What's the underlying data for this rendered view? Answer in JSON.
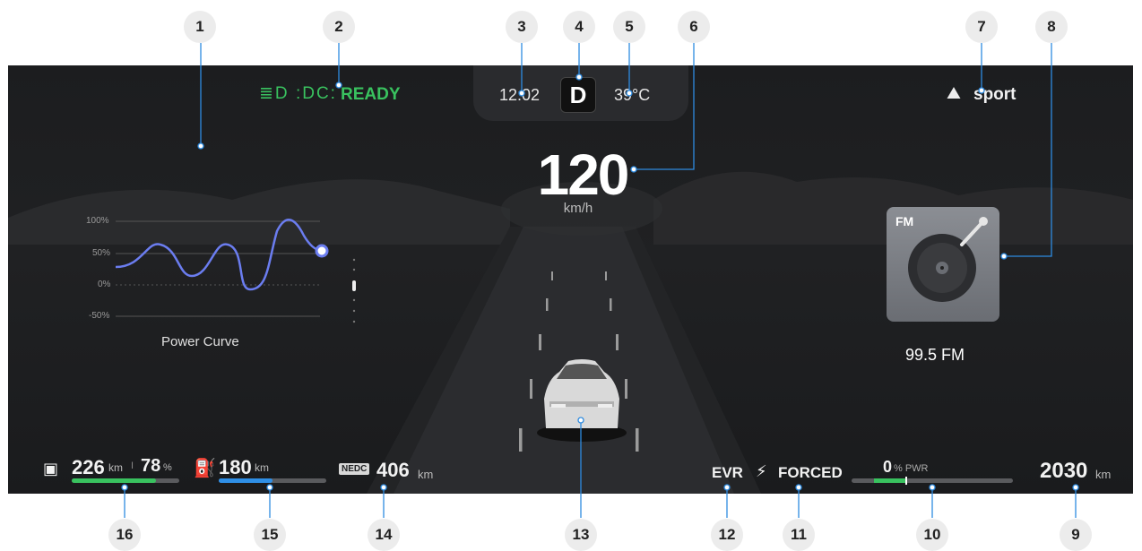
{
  "callouts": [
    "1",
    "2",
    "3",
    "4",
    "5",
    "6",
    "7",
    "8",
    "9",
    "10",
    "11",
    "12",
    "13",
    "14",
    "15",
    "16"
  ],
  "top": {
    "ready": "READY",
    "time": "12:02",
    "gear": "D",
    "temperature": "39°C",
    "drive_mode": "sport"
  },
  "speed": {
    "value": "120",
    "unit": "km/h"
  },
  "power_curve": {
    "title": "Power Curve",
    "ticks": [
      "100%",
      "50%",
      "0%",
      "-50%"
    ]
  },
  "radio": {
    "band": "FM",
    "frequency": "99.5 FM"
  },
  "bottom": {
    "battery_range": "226",
    "battery_range_unit": "km",
    "battery_divider": "I",
    "battery_percent": "78",
    "battery_percent_unit": "%",
    "battery_level": 0.78,
    "fuel_range": "180",
    "fuel_range_unit": "km",
    "fuel_level": 0.5,
    "nedc_badge": "NEDC",
    "nedc_range": "406",
    "nedc_unit": "km",
    "evr": "EVR",
    "forced": "FORCED",
    "pwr_value": "0",
    "pwr_unit": "% PWR",
    "odometer": "2030",
    "odometer_unit": "km"
  },
  "icons": [
    "headlight-icon",
    "fog-light-icon",
    "sport-mode-icon",
    "turntable-icon",
    "battery-icon",
    "fuel-pump-icon",
    "forced-charge-icon",
    "car-icon"
  ],
  "colors": {
    "accent_green": "#39c25f",
    "accent_blue": "#2f8fe6",
    "panel": "#1f2022"
  }
}
